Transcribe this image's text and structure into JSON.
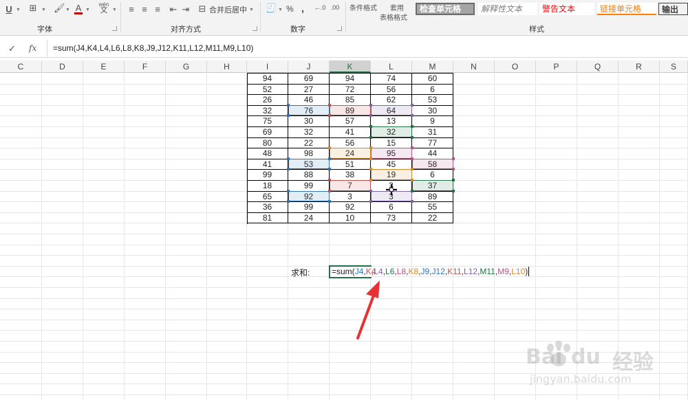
{
  "ribbon": {
    "font_group_label": "字体",
    "align_group_label": "对齐方式",
    "number_group_label": "数字",
    "styles_group_label": "样式",
    "merge_center_label": "合并后居中",
    "conditional_format_label": "条件格式",
    "table_format_label_1": "套用",
    "table_format_label_2": "表格格式",
    "percent_label": "%",
    "comma_label": ",",
    "underline_label": "U",
    "font_color_label": "A",
    "wen_label": "wén",
    "wen_char": "文",
    "styles": {
      "check_cell": "检查单元格",
      "explanatory": "解释性文本",
      "warning": "警告文本",
      "linked_cell": "链接单元格",
      "output": "输出"
    }
  },
  "formula_bar": {
    "confirm_icon": "check-icon",
    "fx_label": "fx",
    "formula": "=sum(J4,K4,L4,L6,L8,K8,J9,J12,K11,L12,M11,M9,L10)"
  },
  "columns": [
    "C",
    "D",
    "E",
    "F",
    "G",
    "H",
    "I",
    "J",
    "K",
    "L",
    "M",
    "N",
    "O",
    "P",
    "Q",
    "R",
    "S"
  ],
  "active_column": "K",
  "table": {
    "rows": [
      [
        94,
        69,
        94,
        74,
        60
      ],
      [
        52,
        27,
        72,
        56,
        6
      ],
      [
        26,
        46,
        85,
        62,
        53
      ],
      [
        32,
        76,
        89,
        64,
        30
      ],
      [
        75,
        30,
        57,
        13,
        9
      ],
      [
        69,
        32,
        41,
        32,
        31
      ],
      [
        80,
        22,
        56,
        15,
        77
      ],
      [
        48,
        98,
        24,
        95,
        44
      ],
      [
        41,
        53,
        51,
        45,
        58
      ],
      [
        99,
        88,
        38,
        19,
        6
      ],
      [
        18,
        99,
        7,
        3,
        37
      ],
      [
        65,
        92,
        3,
        3,
        89
      ],
      [
        36,
        99,
        92,
        6,
        55
      ],
      [
        81,
        24,
        10,
        73,
        22
      ]
    ]
  },
  "sum_label": "求和:",
  "edit_formula": {
    "prefix": "=sum(",
    "refs": [
      {
        "text": "J4",
        "color": "#2e75b6"
      },
      {
        "text": "K4",
        "color": "#c0504d"
      },
      {
        "text": "L4",
        "color": "#8064a2"
      },
      {
        "text": "L6",
        "color": "#217346"
      },
      {
        "text": "L8",
        "color": "#b5548a"
      },
      {
        "text": "K8",
        "color": "#d38a2f"
      },
      {
        "text": "J9",
        "color": "#2e75b6"
      },
      {
        "text": "J12",
        "color": "#2e75b6"
      },
      {
        "text": "K11",
        "color": "#c0504d"
      },
      {
        "text": "L12",
        "color": "#8064a2"
      },
      {
        "text": "M11",
        "color": "#217346"
      },
      {
        "text": "M9",
        "color": "#b5548a"
      },
      {
        "text": "L10",
        "color": "#d38a2f"
      }
    ],
    "suffix": ")"
  },
  "colors": {
    "accent": "#217346",
    "arrow": "#e53333"
  },
  "watermark": {
    "brand": "Bai",
    "brand2": "du",
    "chinese": "经验",
    "url": "jingyan.baidu.com"
  }
}
